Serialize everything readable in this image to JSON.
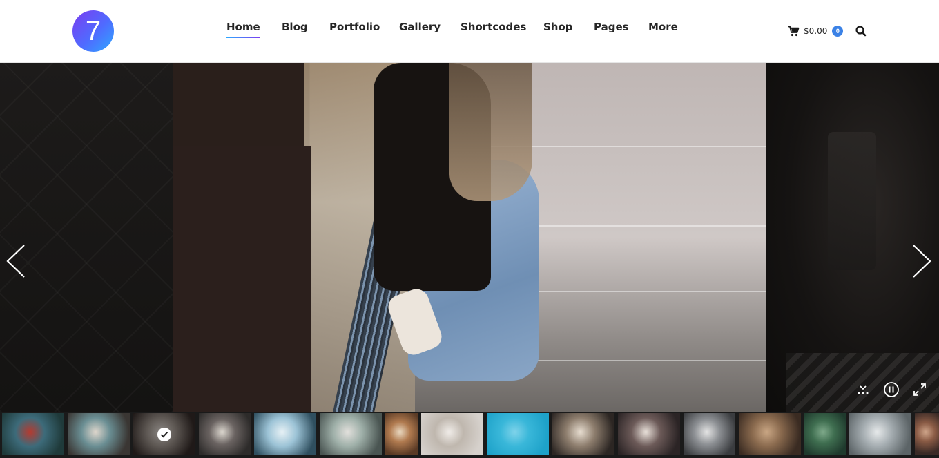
{
  "header": {
    "logo_text": "7",
    "nav": [
      {
        "label": "Home",
        "active": true
      },
      {
        "label": "Blog",
        "active": false
      },
      {
        "label": "Portfolio",
        "active": false
      },
      {
        "label": "Gallery",
        "active": false
      },
      {
        "label": "Shortcodes",
        "active": false
      },
      {
        "label": "Shop",
        "active": false
      },
      {
        "label": "Pages",
        "active": false
      },
      {
        "label": "More",
        "active": false
      }
    ],
    "cart": {
      "total": "$0.00",
      "count": "0",
      "icon": "shopping-cart-icon"
    },
    "search_icon": "search-icon"
  },
  "slideshow": {
    "prev_icon": "chevron-left-icon",
    "next_icon": "chevron-right-icon",
    "controls": [
      {
        "name": "hide-thumbnails-button",
        "icon": "chevron-down-dots-icon"
      },
      {
        "name": "pause-button",
        "icon": "pause-icon"
      },
      {
        "name": "fullscreen-button",
        "icon": "expand-icon"
      }
    ],
    "thumbnails": [
      {
        "subject": "photographer in red beanie",
        "colors": [
          "#1f3a3a",
          "#3d6b7a",
          "#b63a2f"
        ]
      },
      {
        "subject": "top view of person with cup",
        "colors": [
          "#3a3633",
          "#6a8e93",
          "#ded6cc"
        ]
      },
      {
        "subject": "woman leaning on rail",
        "colors": [
          "#2a2220",
          "#7e7670",
          "#b8b2ad"
        ],
        "selected": true
      },
      {
        "subject": "coffee kettle and mug",
        "colors": [
          "#2d2b2a",
          "#6a6361",
          "#dcd7cf"
        ]
      },
      {
        "subject": "mountain lake",
        "colors": [
          "#2f4f5f",
          "#9cc3d6",
          "#e7f1f5"
        ]
      },
      {
        "subject": "open magazine",
        "colors": [
          "#4a5552",
          "#9fb0a9",
          "#e2e0dc"
        ]
      },
      {
        "subject": "cafe interior",
        "colors": [
          "#5a3a25",
          "#b07a4f",
          "#e9d8c0"
        ]
      },
      {
        "subject": "reading book",
        "colors": [
          "#d6d1cc",
          "#bfb7ae",
          "#f0ece8"
        ]
      },
      {
        "subject": "swimmer in blue pool",
        "colors": [
          "#1ea2c9",
          "#39b7d9",
          "#7fd3ea"
        ]
      },
      {
        "subject": "food on table",
        "colors": [
          "#2c2623",
          "#8d7d6d",
          "#e7ddd0"
        ]
      },
      {
        "subject": "hands holding mug",
        "colors": [
          "#2b2425",
          "#6c5a58",
          "#e9e1da"
        ]
      },
      {
        "subject": "woman with sunglasses",
        "colors": [
          "#3a3c3f",
          "#8c8f93",
          "#e4e4e4"
        ]
      },
      {
        "subject": "restaurant tables",
        "colors": [
          "#3a2b22",
          "#8a6a4e",
          "#c9a684"
        ]
      },
      {
        "subject": "pine plant",
        "colors": [
          "#1f3a2d",
          "#3f6e50",
          "#7ea98a"
        ]
      },
      {
        "subject": "laptop on desk",
        "colors": [
          "#5c6467",
          "#a5adb1",
          "#e6e9ea"
        ]
      },
      {
        "subject": "mountains",
        "colors": [
          "#3a2a26",
          "#8a5b45",
          "#cfa58a"
        ]
      }
    ]
  }
}
